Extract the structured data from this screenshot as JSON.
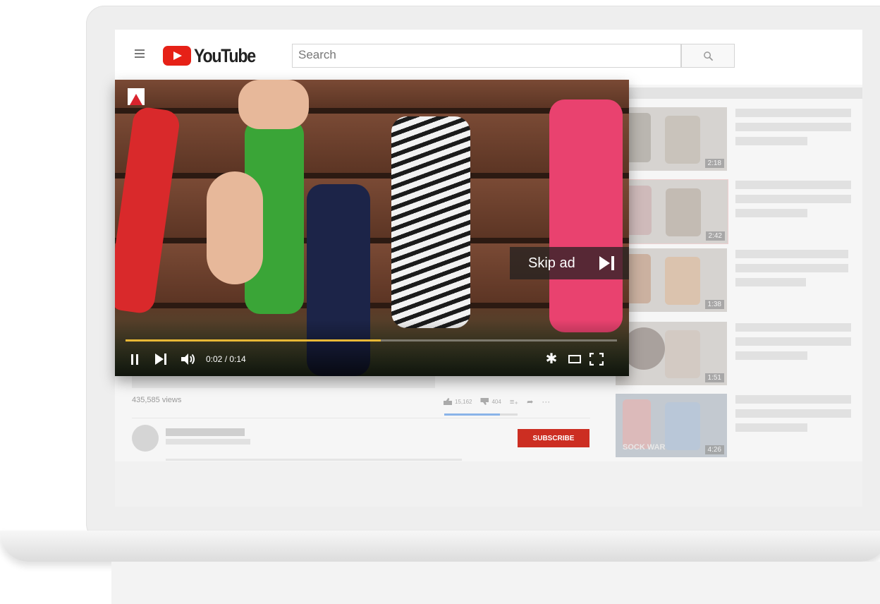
{
  "header": {
    "logo_text": "YouTube",
    "search_placeholder": "Search"
  },
  "player": {
    "skip_ad_label": "Skip ad",
    "time_display": "0:02 / 0:14",
    "progress_fraction": 0.52
  },
  "video_info": {
    "views": "435,585 views",
    "likes": "15,162",
    "dislikes": "404",
    "subscribe_label": "SUBSCRIBE"
  },
  "recommendations": [
    {
      "duration": "2:18"
    },
    {
      "duration": "2:42"
    },
    {
      "duration": "1:38"
    },
    {
      "duration": "1:51"
    },
    {
      "duration": "4:26",
      "caption": "SOCK WAR"
    }
  ],
  "colors": {
    "brand_red": "#e62117",
    "subscribe_red": "#cc2e22",
    "progress_yellow": "#e8b836"
  }
}
